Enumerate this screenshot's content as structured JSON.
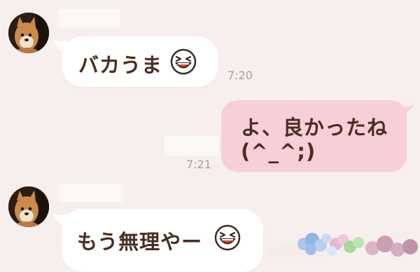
{
  "messages": [
    {
      "side": "incoming",
      "text": "バカうま",
      "emoji": "laughing-face-emoji",
      "time": "7:20"
    },
    {
      "side": "outgoing",
      "line1": "よ、良かったね",
      "line2": "(^_^;)",
      "time": "7:21"
    },
    {
      "side": "incoming",
      "text": "もう無理やー",
      "emoji": "laughing-face-emoji"
    }
  ],
  "colors": {
    "background": "#f6efee",
    "incoming_bubble": "#ffffff",
    "outgoing_bubble": "#f6cfd8",
    "message_text": "#4a2e22",
    "timestamp": "#a5a09e"
  },
  "icons": [
    "shiba-avatar",
    "laughing-face-emoji",
    "flower-decoration"
  ]
}
